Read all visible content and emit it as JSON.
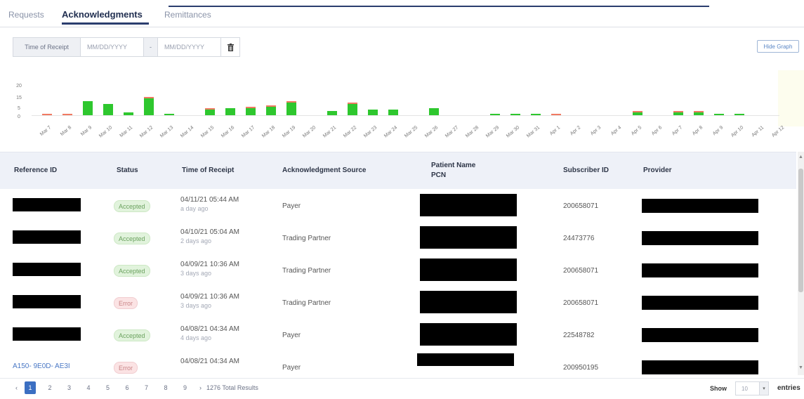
{
  "tabs": {
    "requests": "Requests",
    "acknowledgments": "Acknowledgments",
    "remittances": "Remittances"
  },
  "filter": {
    "label": "Time of Receipt",
    "from_placeholder": "MM/DD/YYYY",
    "separator": "-",
    "to_placeholder": "MM/DD/YYYY",
    "clear_icon": "trash-icon"
  },
  "hide_graph_label": "Hide Graph",
  "chart_data": {
    "type": "bar",
    "stacked": true,
    "ylim": [
      0,
      20
    ],
    "yticks": [
      "20",
      "15",
      "5",
      "0"
    ],
    "categories": [
      "Mar 7",
      "Mar 8",
      "Mar 9",
      "Mar 10",
      "Mar 11",
      "Mar 12",
      "Mar 13",
      "Mar 14",
      "Mar 15",
      "Mar 16",
      "Mar 17",
      "Mar 18",
      "Mar 19",
      "Mar 20",
      "Mar 21",
      "Mar 22",
      "Mar 23",
      "Mar 24",
      "Mar 25",
      "Mar 26",
      "Mar 27",
      "Mar 28",
      "Mar 29",
      "Mar 30",
      "Mar 31",
      "Apr 1",
      "Apr 2",
      "Apr 3",
      "Apr 4",
      "Apr 5",
      "Apr 6",
      "Apr 7",
      "Apr 8",
      "Apr 9",
      "Apr 10",
      "Apr 11",
      "Apr 12"
    ],
    "series": [
      {
        "color": "#2ec72e",
        "values": [
          0,
          0,
          10,
          8,
          2,
          12,
          1,
          0,
          4,
          5,
          5,
          6,
          9,
          0,
          3,
          8,
          4,
          4,
          0,
          5,
          0,
          0,
          1,
          1,
          1,
          0,
          0,
          0,
          0,
          2,
          0,
          2,
          2,
          1,
          1,
          0,
          0
        ]
      },
      {
        "color": "#f07a63",
        "values": [
          1,
          1,
          0,
          0,
          0,
          1,
          0,
          0,
          1,
          0,
          1,
          1,
          1,
          0,
          0,
          1,
          0,
          0,
          0,
          0,
          0,
          0,
          0,
          0,
          0,
          1,
          0,
          0,
          0,
          1,
          0,
          1,
          1,
          0,
          0,
          0,
          0
        ]
      }
    ],
    "grid": false
  },
  "table": {
    "headers": {
      "reference_id": "Reference ID",
      "status": "Status",
      "time_of_receipt": "Time of Receipt",
      "ack_source": "Acknowledgment Source",
      "patient_name": "Patient Name",
      "pcn": "PCN",
      "subscriber_id": "Subscriber ID",
      "provider": "Provider"
    },
    "rows": [
      {
        "ref": "",
        "status": "Accepted",
        "time": "04/11/21 05:44 AM",
        "ago": "a day ago",
        "source": "Payer",
        "subscriber": "200658071"
      },
      {
        "ref": "",
        "status": "Accepted",
        "time": "04/10/21 05:04 AM",
        "ago": "2 days ago",
        "source": "Trading Partner",
        "subscriber": "24473776"
      },
      {
        "ref": "",
        "status": "Accepted",
        "time": "04/09/21 10:36 AM",
        "ago": "3 days ago",
        "source": "Trading Partner",
        "subscriber": "200658071"
      },
      {
        "ref": "",
        "status": "Error",
        "time": "04/09/21 10:36 AM",
        "ago": "3 days ago",
        "source": "Trading Partner",
        "subscriber": "200658071"
      },
      {
        "ref": "",
        "status": "Accepted",
        "time": "04/08/21 04:34 AM",
        "ago": "4 days ago",
        "source": "Payer",
        "subscriber": "22548782"
      },
      {
        "ref": "A150- 9E0D- AE3I",
        "status": "Error",
        "time": "04/08/21 04:34 AM",
        "ago": "",
        "source": "Payer",
        "subscriber": "200950195"
      }
    ]
  },
  "pagination": {
    "prev": "‹",
    "pages": [
      "1",
      "2",
      "3",
      "4",
      "5",
      "6",
      "7",
      "8",
      "9"
    ],
    "current": "1",
    "next": "›",
    "total": "1276 Total Results"
  },
  "page_size": {
    "label": "Show",
    "value": "10",
    "suffix": "entries"
  }
}
